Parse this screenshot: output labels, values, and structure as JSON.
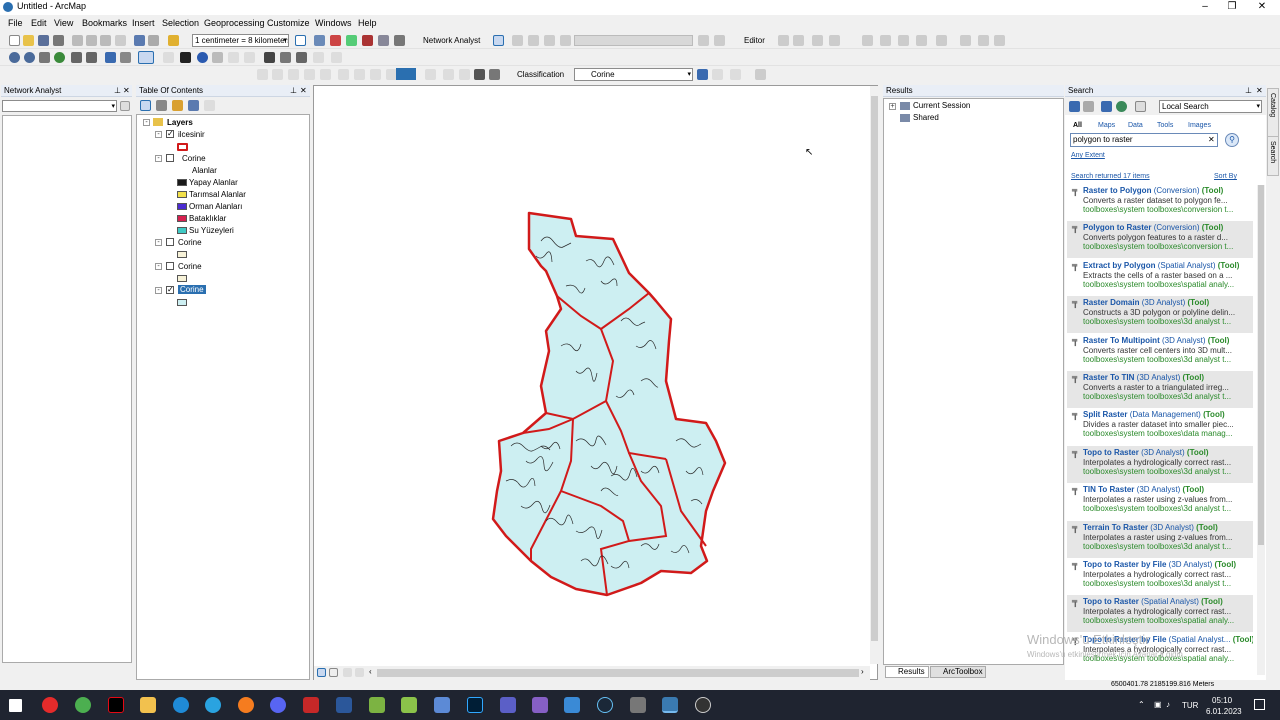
{
  "window": {
    "title": "Untitled - ArcMap"
  },
  "menu": [
    "File",
    "Edit",
    "View",
    "Bookmarks",
    "Insert",
    "Selection",
    "Geoprocessing",
    "Customize",
    "Windows",
    "Help"
  ],
  "toolbar": {
    "scale": "1 centimeter = 8 kilometers",
    "network_analyst": "Network Analyst",
    "editor": "Editor",
    "classification": "Classification",
    "layer_combo": "Corine"
  },
  "network_analyst_panel": {
    "title": "Network Analyst"
  },
  "toc": {
    "title": "Table Of Contents",
    "root": "Layers",
    "layers": [
      {
        "name": "ilcesinir",
        "checked": true
      },
      {
        "name": "Corine",
        "checked": false,
        "field": "Alanlar",
        "classes": [
          {
            "label": "Yapay Alanlar",
            "color": "#1a1a1a"
          },
          {
            "label": "Tarımsal Alanlar",
            "color": "#f2e04a"
          },
          {
            "label": "Orman Alanları",
            "color": "#4b2bd1"
          },
          {
            "label": "Bataklıklar",
            "color": "#d6204f"
          },
          {
            "label": "Su Yüzeyleri",
            "color": "#3fc9c4"
          }
        ]
      },
      {
        "name": "Corine",
        "checked": false
      },
      {
        "name": "Corine",
        "checked": false
      },
      {
        "name": "Corine",
        "checked": true,
        "selected": true
      }
    ]
  },
  "results": {
    "title": "Results",
    "items": [
      "Current Session",
      "Shared"
    ],
    "tabs": [
      "Results",
      "ArcToolbox"
    ]
  },
  "search": {
    "title": "Search",
    "scope": "Local Search",
    "filters": [
      "All",
      "Maps",
      "Data",
      "Tools",
      "Images"
    ],
    "query": "polygon to raster",
    "extent": "Any Extent",
    "returned": "Search returned 17 items",
    "sort": "Sort By",
    "results": [
      {
        "name": "Raster to Polygon",
        "cat": "(Conversion)",
        "desc": "Converts a raster dataset to polygon fe...",
        "path": "toolboxes\\system toolboxes\\conversion t..."
      },
      {
        "name": "Polygon to Raster",
        "cat": "(Conversion)",
        "desc": "Converts polygon features to a raster d...",
        "path": "toolboxes\\system toolboxes\\conversion t..."
      },
      {
        "name": "Extract by Polygon",
        "cat": "(Spatial Analyst)",
        "desc": "Extracts the cells of a raster based on a ...",
        "path": "toolboxes\\system toolboxes\\spatial analy..."
      },
      {
        "name": "Raster Domain",
        "cat": "(3D Analyst)",
        "desc": "Constructs a 3D polygon or polyline delin...",
        "path": "toolboxes\\system toolboxes\\3d analyst t..."
      },
      {
        "name": "Raster To Multipoint",
        "cat": "(3D Analyst)",
        "desc": "Converts raster cell centers into 3D mult...",
        "path": "toolboxes\\system toolboxes\\3d analyst t..."
      },
      {
        "name": "Raster To TIN",
        "cat": "(3D Analyst)",
        "desc": "Converts a raster to a triangulated irreg...",
        "path": "toolboxes\\system toolboxes\\3d analyst t..."
      },
      {
        "name": "Split Raster",
        "cat": "(Data Management)",
        "desc": "Divides a raster dataset into smaller piec...",
        "path": "toolboxes\\system toolboxes\\data manag..."
      },
      {
        "name": "Topo to Raster",
        "cat": "(3D Analyst)",
        "desc": "Interpolates a hydrologically correct rast...",
        "path": "toolboxes\\system toolboxes\\3d analyst t..."
      },
      {
        "name": "TIN To Raster",
        "cat": "(3D Analyst)",
        "desc": "Interpolates a raster using z-values from...",
        "path": "toolboxes\\system toolboxes\\3d analyst t..."
      },
      {
        "name": "Terrain To Raster",
        "cat": "(3D Analyst)",
        "desc": "Interpolates a raster using z-values from...",
        "path": "toolboxes\\system toolboxes\\3d analyst t..."
      },
      {
        "name": "Topo to Raster by File",
        "cat": "(3D Analyst)",
        "desc": "Interpolates a hydrologically correct rast...",
        "path": "toolboxes\\system toolboxes\\3d analyst t..."
      },
      {
        "name": "Topo to Raster",
        "cat": "(Spatial Analyst)",
        "desc": "Interpolates a hydrologically correct rast...",
        "path": "toolboxes\\system toolboxes\\spatial analy..."
      },
      {
        "name": "Topo to Raster by File",
        "cat": "(Spatial Analyst...",
        "desc": "Interpolates a hydrologically correct rast...",
        "path": "toolboxes\\system toolboxes\\spatial analy..."
      }
    ],
    "tool_suffix": "(Tool)"
  },
  "side_tabs": [
    "Catalog",
    "Search"
  ],
  "status": {
    "coords": "6500401.78  2185199.816 Meters"
  },
  "watermark": {
    "line1": "Windows'u Etkinleştir",
    "line2": "Windows'u etkinleştirmek için Ayarlar'a gidin."
  },
  "taskbar": {
    "lang": "TUR",
    "time": "05:10",
    "date": "6.01.2023"
  },
  "colors": {
    "map_fill": "#cdeff2",
    "boundary": "#d11a1a",
    "accent": "#1a56a8",
    "tool_green": "#2a8a2a"
  }
}
